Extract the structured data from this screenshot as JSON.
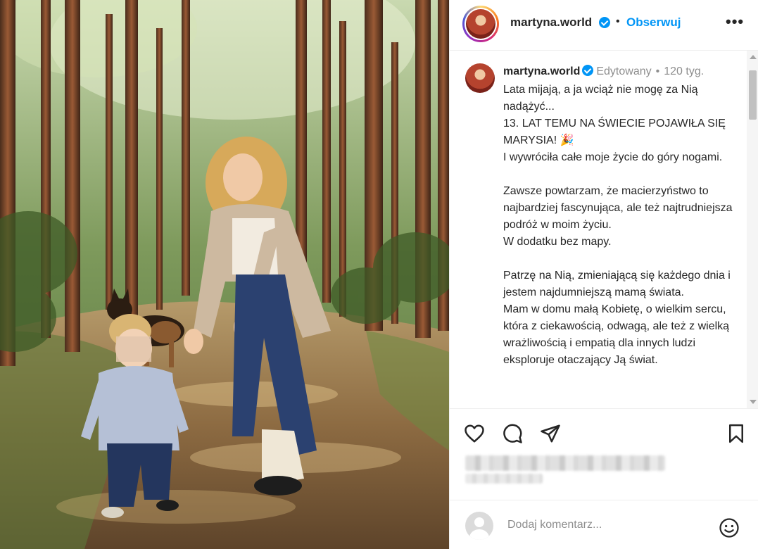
{
  "post": {
    "image_alt": "",
    "username": "martyna.world",
    "verified": true,
    "follow_label": "Obserwuj",
    "header_dot": "•",
    "more_label": "•••"
  },
  "caption": {
    "username": "martyna.world",
    "edited_label": "Edytowany",
    "separator": "•",
    "time": "120 tyg.",
    "paragraphs": [
      "Lata mijają, a ja wciąż nie mogę za Nią nadążyć...",
      "13. LAT TEMU NA ŚWIECIE POJAWIŁA SIĘ MARYSIA! 🎉",
      "I wywróciła całe moje życie do góry nogami.",
      "",
      "Zawsze powtarzam, że macierzyństwo to najbardziej fascynująca, ale też najtrudniejsza podróż w moim życiu.",
      "W dodatku bez mapy.",
      "",
      "Patrzę na Nią, zmieniającą się każdego dnia i jestem najdumniejszą mamą świata.",
      "Mam w domu małą Kobietę, o wielkim sercu, która z ciekawością, odwagą, ale też z wielką wrażliwością i empatią dla innych ludzi eksploruje otaczający Ją świat."
    ]
  },
  "actions": {
    "like_icon": "heart-icon",
    "comment_icon": "comment-icon",
    "share_icon": "paper-plane-icon",
    "save_icon": "bookmark-icon"
  },
  "comment": {
    "placeholder": "Dodaj komentarz...",
    "emoji_icon": "smiley-icon"
  },
  "colors": {
    "accent": "#0095f6",
    "text": "#262626",
    "muted": "#8e8e8e"
  }
}
